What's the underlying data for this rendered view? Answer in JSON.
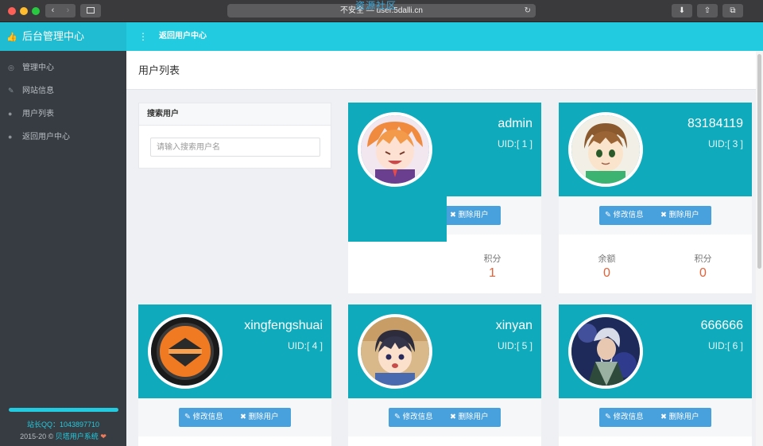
{
  "browser": {
    "address": "不安全 — user.5dalli.cn",
    "watermark": "资源社区"
  },
  "app": {
    "brand": "后台管理中心",
    "top_link": "返回用户中心"
  },
  "sidebar": {
    "items": [
      {
        "label": "管理中心",
        "icon": "gauge-icon"
      },
      {
        "label": "网站信息",
        "icon": "pencil-icon"
      },
      {
        "label": "用户列表",
        "icon": "user-icon"
      },
      {
        "label": "返回用户中心",
        "icon": "user-icon"
      }
    ],
    "qq": "站长QQ：1043897710",
    "copyright_prefix": "2015-20 © ",
    "copyright_link": "贝塔用户系统",
    "accent": "#22cbe0"
  },
  "main": {
    "title": "用户列表",
    "search": {
      "title": "搜索用户",
      "placeholder": "请输入搜索用户名"
    },
    "edit_label": "修改信息",
    "delete_label": "删除用户",
    "users": [
      {
        "name": "admin",
        "uid": "UID:[ 1 ]",
        "stats": [
          {
            "label": "积分",
            "value": "1"
          }
        ]
      },
      {
        "name": "83184119",
        "uid": "UID:[ 3 ]",
        "stats": [
          {
            "label": "余额",
            "value": "0"
          },
          {
            "label": "积分",
            "value": "0"
          }
        ]
      },
      {
        "name": "xingfengshuai",
        "uid": "UID:[ 4 ]"
      },
      {
        "name": "xinyan",
        "uid": "UID:[ 5 ]"
      },
      {
        "name": "666666",
        "uid": "UID:[ 6 ]"
      }
    ]
  }
}
